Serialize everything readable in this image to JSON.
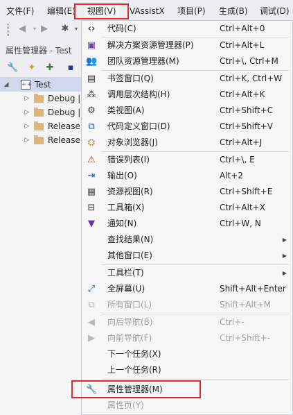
{
  "menubar": {
    "items": [
      "文件(F)",
      "编辑(E)",
      "视图(V)",
      "VAssistX",
      "项目(P)",
      "生成(B)",
      "调试(D)"
    ]
  },
  "panel": {
    "title": "属性管理器 - Test",
    "tree": [
      {
        "label": "Test",
        "expanded": true
      },
      {
        "label": "Debug |"
      },
      {
        "label": "Debug |"
      },
      {
        "label": "Release"
      },
      {
        "label": "Release"
      }
    ]
  },
  "view_menu": {
    "items": [
      {
        "label": "代码(C)",
        "shortcut": "Ctrl+Alt+0",
        "icon": "code-brackets-icon"
      },
      {
        "label": "解决方案资源管理器(P)",
        "shortcut": "Ctrl+Alt+L",
        "icon": "solution-explorer-icon"
      },
      {
        "label": "团队资源管理器(M)",
        "shortcut": "Ctrl+\\, Ctrl+M",
        "icon": "team-explorer-icon"
      },
      {
        "label": "书签窗口(Q)",
        "shortcut": "Ctrl+K, Ctrl+W",
        "icon": "bookmark-icon"
      },
      {
        "label": "调用层次结构(H)",
        "shortcut": "Ctrl+Alt+K",
        "icon": "call-hierarchy-icon"
      },
      {
        "label": "类视图(A)",
        "shortcut": "Ctrl+Shift+C",
        "icon": "class-view-icon"
      },
      {
        "label": "代码定义窗口(D)",
        "shortcut": "Ctrl+Shift+V",
        "icon": "code-definition-icon"
      },
      {
        "label": "对象浏览器(J)",
        "shortcut": "Ctrl+Alt+J",
        "icon": "object-browser-icon"
      },
      {
        "label": "错误列表(I)",
        "shortcut": "Ctrl+\\, E",
        "icon": "error-list-icon"
      },
      {
        "label": "输出(O)",
        "shortcut": "Alt+2",
        "icon": "output-icon"
      },
      {
        "label": "资源视图(R)",
        "shortcut": "Ctrl+Shift+E",
        "icon": "resource-view-icon"
      },
      {
        "label": "工具箱(X)",
        "shortcut": "Ctrl+Alt+X",
        "icon": "toolbox-icon"
      },
      {
        "label": "通知(N)",
        "shortcut": "Ctrl+W, N",
        "icon": "notification-flag-icon"
      },
      {
        "label": "查找结果(N)",
        "shortcut": "",
        "icon": ""
      },
      {
        "label": "其他窗口(E)",
        "shortcut": "",
        "icon": ""
      },
      {
        "label": "工具栏(T)",
        "shortcut": "",
        "icon": ""
      },
      {
        "label": "全屏幕(U)",
        "shortcut": "Shift+Alt+Enter",
        "icon": "fullscreen-icon"
      },
      {
        "label": "所有窗口(L)",
        "shortcut": "Shift+Alt+M",
        "icon": "all-windows-icon"
      },
      {
        "label": "向后导航(B)",
        "shortcut": "Ctrl+-",
        "icon": "navigate-back-icon"
      },
      {
        "label": "向前导航(F)",
        "shortcut": "Ctrl+Shift+-",
        "icon": "navigate-forward-icon"
      },
      {
        "label": "下一个任务(X)",
        "shortcut": "",
        "icon": ""
      },
      {
        "label": "上一个任务(R)",
        "shortcut": "",
        "icon": ""
      },
      {
        "label": "属性管理器(M)",
        "shortcut": "",
        "icon": "wrench-icon"
      },
      {
        "label": "属性页(Y)",
        "shortcut": "",
        "icon": ""
      }
    ]
  },
  "colors": {
    "highlight_box": "#e3272b",
    "menu_background": "#f6f6f6",
    "ide_background": "#eeeef2",
    "tree_selection": "#cfd8ee",
    "folder": "#dcb67a"
  }
}
